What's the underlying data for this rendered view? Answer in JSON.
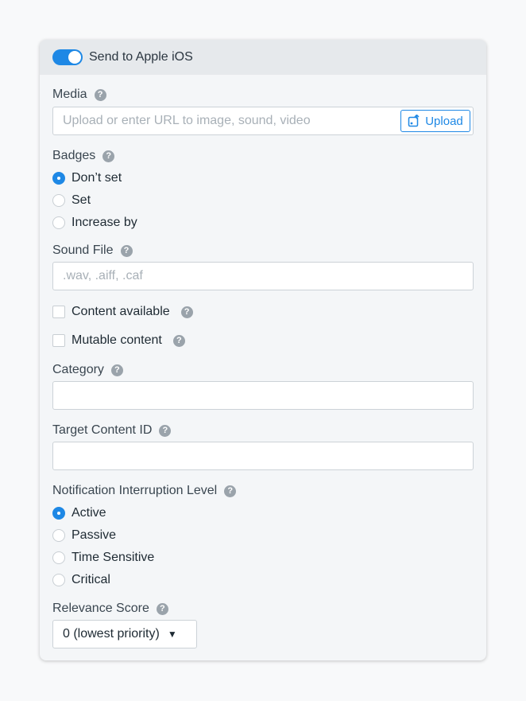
{
  "header": {
    "toggle_on": true,
    "title": "Send to Apple iOS",
    "accent_color": "#1e88e5"
  },
  "media": {
    "label": "Media",
    "placeholder": "Upload or enter URL to image, sound, video",
    "value": "",
    "upload_label": "Upload"
  },
  "badges": {
    "label": "Badges",
    "options": [
      "Don’t set",
      "Set",
      "Increase by"
    ],
    "selected": "Don’t set"
  },
  "sound_file": {
    "label": "Sound File",
    "placeholder": ".wav, .aiff, .caf",
    "value": ""
  },
  "content_available": {
    "label": "Content available",
    "checked": false
  },
  "mutable_content": {
    "label": "Mutable content",
    "checked": false
  },
  "category": {
    "label": "Category",
    "value": ""
  },
  "target_content_id": {
    "label": "Target Content ID",
    "value": ""
  },
  "interruption_level": {
    "label": "Notification Interruption Level",
    "options": [
      "Active",
      "Passive",
      "Time Sensitive",
      "Critical"
    ],
    "selected": "Active"
  },
  "relevance_score": {
    "label": "Relevance Score",
    "selected": "0 (lowest priority)"
  },
  "help_glyph": "?"
}
